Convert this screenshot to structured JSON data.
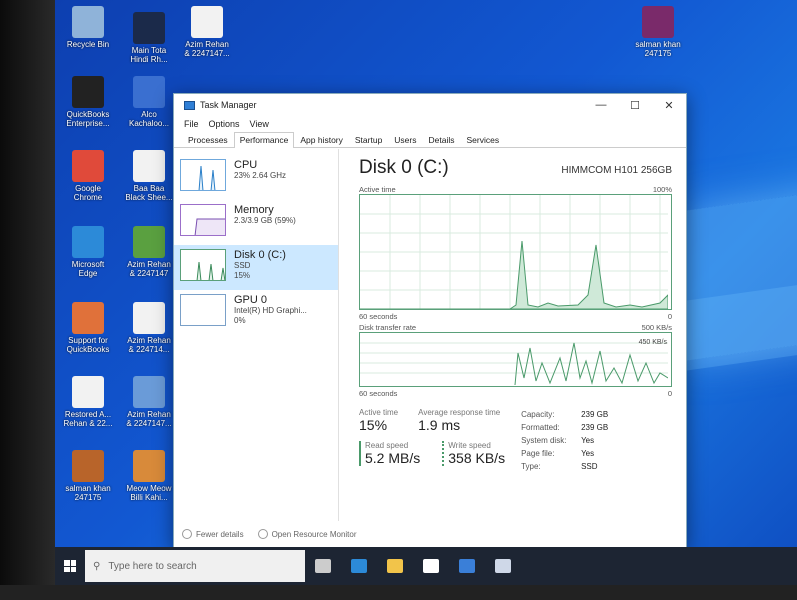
{
  "desktop": {
    "icons": [
      {
        "label": "Recycle Bin",
        "color": "#8fb3d9"
      },
      {
        "label": "Main Tota\nHindi Rh...",
        "color": "#1b2a4a"
      },
      {
        "label": "Azim Rehan\n& 2247147...",
        "color": "#f2f2f2"
      },
      {
        "label": "QuickBooks\nEnterprise...",
        "color": "#222222"
      },
      {
        "label": "Alco\nKachaloo...",
        "color": "#3a6fd0"
      },
      {
        "label": "Google\nChrome",
        "color": "#e04a3a"
      },
      {
        "label": "Baa Baa\nBlack Shee...",
        "color": "#f2f2f2"
      },
      {
        "label": "Microsoft\nEdge",
        "color": "#2c8ad8"
      },
      {
        "label": "Azim Rehan\n& 2247147",
        "color": "#5aa040"
      },
      {
        "label": "Support for\nQuickBooks",
        "color": "#e0713a"
      },
      {
        "label": "Azim Rehan\n& 224714...",
        "color": "#f2f2f2"
      },
      {
        "label": "Restored A...\nRehan & 22...",
        "color": "#f2f2f2"
      },
      {
        "label": "Azim Rehan\n& 2247147...",
        "color": "#6a9bd8"
      },
      {
        "label": "salman khan\n247175",
        "color": "#7a2a6a"
      },
      {
        "label": "Meow Meow\nBilli Kahi...",
        "color": "#d88a3a"
      },
      {
        "label": "salman khan\n247175",
        "color": "#b8642a"
      }
    ]
  },
  "taskmanager": {
    "title": "Task Manager",
    "menu": [
      "File",
      "Options",
      "View"
    ],
    "tabs": [
      "Processes",
      "Performance",
      "App history",
      "Startup",
      "Users",
      "Details",
      "Services"
    ],
    "active_tab": "Performance",
    "resources": [
      {
        "name": "CPU",
        "sub1": "23%  2.64 GHz",
        "sub2": ""
      },
      {
        "name": "Memory",
        "sub1": "2.3/3.9 GB (59%)",
        "sub2": ""
      },
      {
        "name": "Disk 0 (C:)",
        "sub1": "SSD",
        "sub2": "15%"
      },
      {
        "name": "GPU 0",
        "sub1": "Intel(R) HD Graphi...",
        "sub2": "0%"
      }
    ],
    "disk": {
      "title": "Disk 0 (C:)",
      "model": "HIMMCOM H101 256GB",
      "active_time_label": "Active time",
      "active_time_max": "100%",
      "seconds_label": "60 seconds",
      "zero": "0",
      "transfer_label": "Disk transfer rate",
      "transfer_max": "500 KB/s",
      "transfer_mark": "450 KB/s",
      "stats": {
        "active_time_label": "Active time",
        "active_time": "15%",
        "response_label": "Average response time",
        "response": "1.9 ms",
        "read_label": "Read speed",
        "read": "5.2 MB/s",
        "write_label": "Write speed",
        "write": "358 KB/s"
      },
      "props": [
        {
          "k": "Capacity:",
          "v": "239 GB"
        },
        {
          "k": "Formatted:",
          "v": "239 GB"
        },
        {
          "k": "System disk:",
          "v": "Yes"
        },
        {
          "k": "Page file:",
          "v": "Yes"
        },
        {
          "k": "Type:",
          "v": "SSD"
        }
      ]
    },
    "footer": {
      "fewer": "Fewer details",
      "monitor": "Open Resource Monitor"
    }
  },
  "taskbar": {
    "search_placeholder": "Type here to search",
    "pinned": [
      {
        "name": "task-view",
        "color": "#cccccc"
      },
      {
        "name": "edge",
        "color": "#2c8ad8"
      },
      {
        "name": "file-explorer",
        "color": "#f2c44a"
      },
      {
        "name": "store",
        "color": "#ffffff"
      },
      {
        "name": "mail",
        "color": "#3a7fd8"
      },
      {
        "name": "task-manager",
        "color": "#cfd8e8"
      }
    ]
  }
}
